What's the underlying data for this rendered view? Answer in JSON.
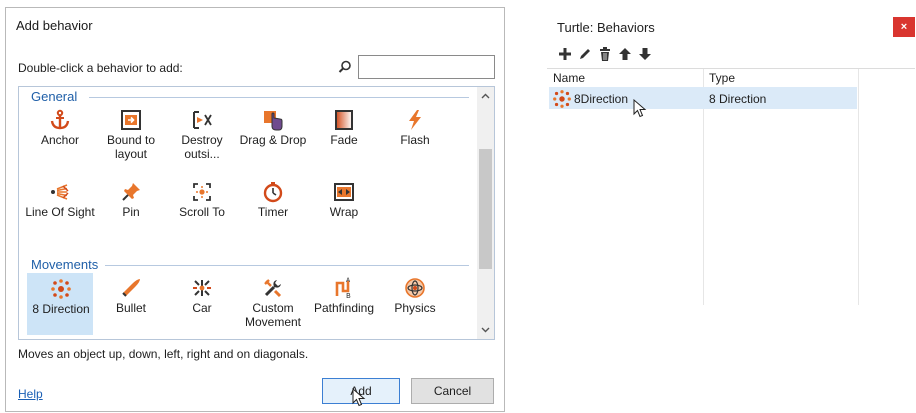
{
  "dialog": {
    "title": "Add behavior",
    "instruction": "Double-click a behavior to add:",
    "search": {
      "value": "",
      "placeholder": ""
    },
    "categories": [
      {
        "name": "General",
        "items": [
          {
            "label": "Anchor",
            "icon": "anchor-icon"
          },
          {
            "label": "Bound to layout",
            "icon": "bound-to-layout-icon"
          },
          {
            "label": "Destroy outsi...",
            "icon": "destroy-outside-icon"
          },
          {
            "label": "Drag & Drop",
            "icon": "drag-drop-icon"
          },
          {
            "label": "Fade",
            "icon": "fade-icon"
          },
          {
            "label": "Flash",
            "icon": "flash-icon"
          },
          {
            "label": "Line Of Sight",
            "icon": "line-of-sight-icon"
          },
          {
            "label": "Pin",
            "icon": "pin-icon"
          },
          {
            "label": "Scroll To",
            "icon": "scroll-to-icon"
          },
          {
            "label": "Timer",
            "icon": "timer-icon"
          },
          {
            "label": "Wrap",
            "icon": "wrap-icon"
          }
        ]
      },
      {
        "name": "Movements",
        "items": [
          {
            "label": "8 Direction",
            "icon": "eight-direction-icon",
            "selected": true
          },
          {
            "label": "Bullet",
            "icon": "bullet-icon"
          },
          {
            "label": "Car",
            "icon": "car-icon"
          },
          {
            "label": "Custom Movement",
            "icon": "custom-movement-icon"
          },
          {
            "label": "Pathfinding",
            "icon": "pathfinding-icon"
          },
          {
            "label": "Physics",
            "icon": "physics-icon"
          }
        ]
      }
    ],
    "description": "Moves an object up, down, left, right and on diagonals.",
    "help_label": "Help",
    "add_label": "Add",
    "cancel_label": "Cancel"
  },
  "panel": {
    "title": "Turtle: Behaviors",
    "close_label": "×",
    "toolbar": [
      "add-icon",
      "edit-icon",
      "delete-icon",
      "move-up-icon",
      "move-down-icon"
    ],
    "columns": [
      "Name",
      "Type"
    ],
    "rows": [
      {
        "name": "8Direction",
        "type": "8 Direction",
        "icon": "eight-direction-icon"
      }
    ]
  },
  "colors": {
    "category_title": "#1f5fa8",
    "selection": "#cde4f7",
    "close_button": "#d9352f",
    "link": "#1a5fb4"
  }
}
